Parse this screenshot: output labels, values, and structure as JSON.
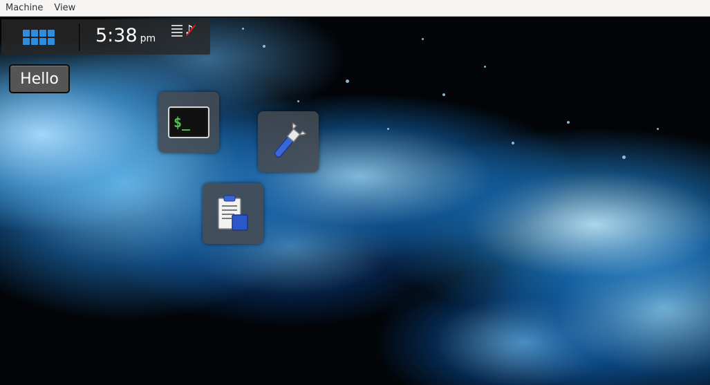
{
  "menubar": {
    "items": [
      {
        "label": "Machine"
      },
      {
        "label": "View"
      }
    ]
  },
  "panel": {
    "apps_icon": "grid-apps-icon",
    "clock": {
      "time": "5:38",
      "ampm": "pm"
    },
    "tray": {
      "list_icon": "list-icon",
      "sound_icon": "music-muted-icon"
    }
  },
  "desktop": {
    "hello_button": {
      "label": "Hello"
    },
    "icons": [
      {
        "name": "terminal",
        "icon": "terminal-icon",
        "prompt_text": "$_"
      },
      {
        "name": "settings",
        "icon": "wrench-icon"
      },
      {
        "name": "clipboard",
        "icon": "clipboard-icon"
      }
    ]
  },
  "colors": {
    "accent_blue": "#2f8de0",
    "terminal_green": "#4ec34e",
    "muted_red": "#e0181e",
    "panel_bg": "#282828"
  }
}
